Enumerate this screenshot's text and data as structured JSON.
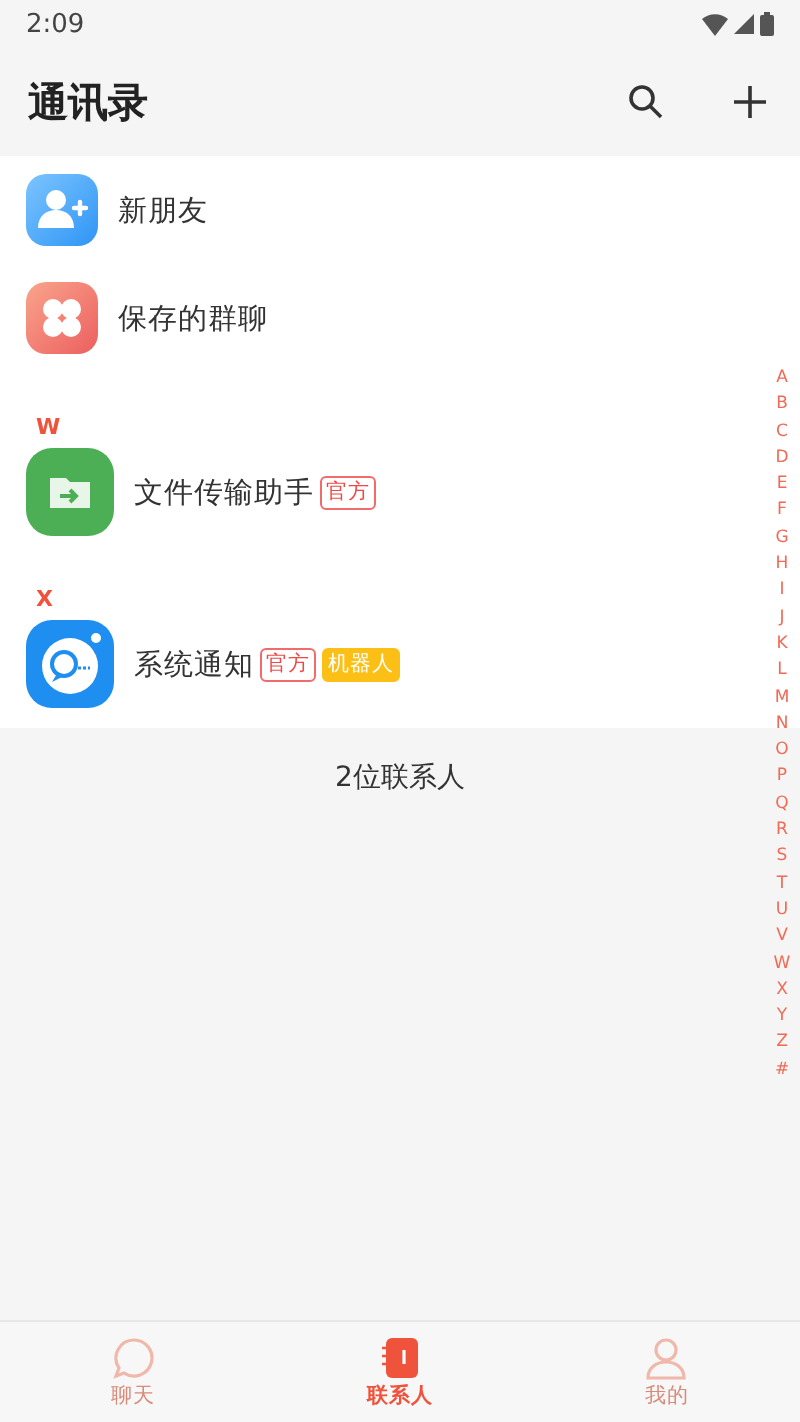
{
  "status_bar": {
    "time": "2:09"
  },
  "header": {
    "title": "通讯录"
  },
  "shortcuts": [
    {
      "kind": "new_friend",
      "label": "新朋友"
    },
    {
      "kind": "saved_groups",
      "label": "保存的群聊"
    }
  ],
  "sections": [
    {
      "letter": "W",
      "contacts": [
        {
          "kind": "file_transfer",
          "name": "文件传输助手",
          "tags": [
            {
              "kind": "official",
              "text": "官方"
            }
          ]
        }
      ]
    },
    {
      "letter": "X",
      "contacts": [
        {
          "kind": "notification",
          "name": "系统通知",
          "tags": [
            {
              "kind": "official",
              "text": "官方"
            },
            {
              "kind": "robot",
              "text": "机器人"
            }
          ]
        }
      ]
    }
  ],
  "footer_count": "2位联系人",
  "index": [
    "A",
    "B",
    "C",
    "D",
    "E",
    "F",
    "G",
    "H",
    "I",
    "J",
    "K",
    "L",
    "M",
    "N",
    "O",
    "P",
    "Q",
    "R",
    "S",
    "T",
    "U",
    "V",
    "W",
    "X",
    "Y",
    "Z",
    "#"
  ],
  "tabs": [
    {
      "kind": "chat",
      "label": "聊天",
      "selected": false
    },
    {
      "kind": "contacts",
      "label": "联系人",
      "selected": true
    },
    {
      "kind": "me",
      "label": "我的",
      "selected": false
    }
  ]
}
